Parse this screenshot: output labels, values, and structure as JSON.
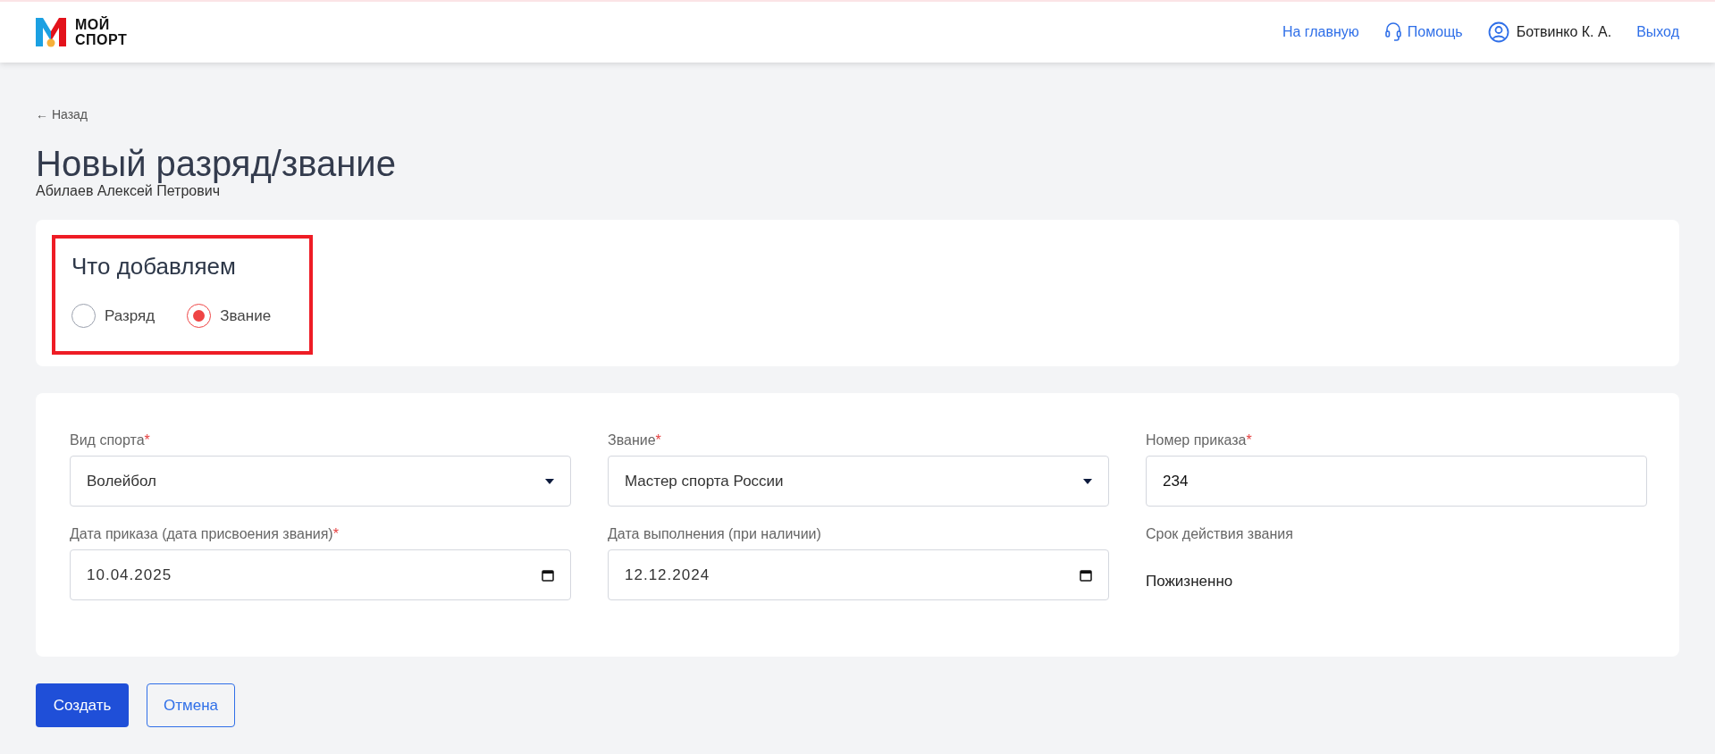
{
  "header": {
    "logo_text": [
      "МОЙ",
      "СПОРТ"
    ],
    "nav": [
      {
        "kind": "link",
        "label": "На главную"
      },
      {
        "kind": "help",
        "label": "Помощь"
      },
      {
        "kind": "user",
        "label": "Ботвинко К. А."
      },
      {
        "kind": "link",
        "label": "Выход"
      }
    ]
  },
  "back_link": {
    "arrow": "←",
    "label": "Назад"
  },
  "title": "Новый разряд/звание",
  "subtitle": "Абилаев Алексей Петрович",
  "type_card": {
    "heading": "Что добавляем",
    "options": [
      {
        "label": "Разряд",
        "selected": false
      },
      {
        "label": "Звание",
        "selected": true
      }
    ]
  },
  "form": {
    "fields": [
      {
        "kind": "select",
        "label": "Вид спорта",
        "required_mark": "*",
        "value": "Волейбол"
      },
      {
        "kind": "select",
        "label": "Звание",
        "required_mark": "*",
        "value": "Мастер спорта России"
      },
      {
        "kind": "text",
        "label": "Номер приказа",
        "required_mark": "*",
        "value": "234"
      },
      {
        "kind": "date",
        "label": "Дата приказа (дата присвоения звания)",
        "required_mark": "*",
        "value": "10.04.2025"
      },
      {
        "kind": "date",
        "label": "Дата выполнения (при наличии)",
        "value": "12.12.2024"
      },
      {
        "kind": "static",
        "label": "Срок действия звания",
        "value": "Пожизненно"
      }
    ]
  },
  "buttons": [
    {
      "kind": "primary",
      "label": "Создать"
    },
    {
      "kind": "secondary",
      "label": "Отмена"
    }
  ]
}
